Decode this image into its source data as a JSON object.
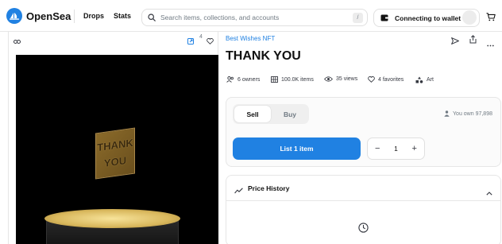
{
  "header": {
    "brand": "OpenSea",
    "nav": [
      "Drops",
      "Stats"
    ],
    "search_placeholder": "Search items, collections, and accounts",
    "search_shortcut": "/",
    "wallet_label": "Connecting to wallet"
  },
  "item": {
    "favorites_count": "4",
    "artwork_text": [
      "THANK",
      "YOU"
    ],
    "collection": "Best Wishes NFT",
    "title": "THANK YOU",
    "stats": [
      {
        "icon": "owners-icon",
        "label": "6 owners"
      },
      {
        "icon": "grid-icon",
        "label": "100.0K items"
      },
      {
        "icon": "eye-icon",
        "label": "35 views"
      },
      {
        "icon": "heart-icon",
        "label": "4 favorites"
      },
      {
        "icon": "category-icon",
        "label": "Art"
      }
    ]
  },
  "trade": {
    "tabs": [
      "Sell",
      "Buy"
    ],
    "selected_tab": "Sell",
    "ownership": "You own 97,898",
    "primary_button": "List 1 item",
    "quantity": "1",
    "decrement": "−",
    "increment": "+"
  },
  "price_history": {
    "title": "Price History"
  },
  "colors": {
    "accent": "#2081e2",
    "text": "#121212",
    "muted": "#707a83"
  }
}
